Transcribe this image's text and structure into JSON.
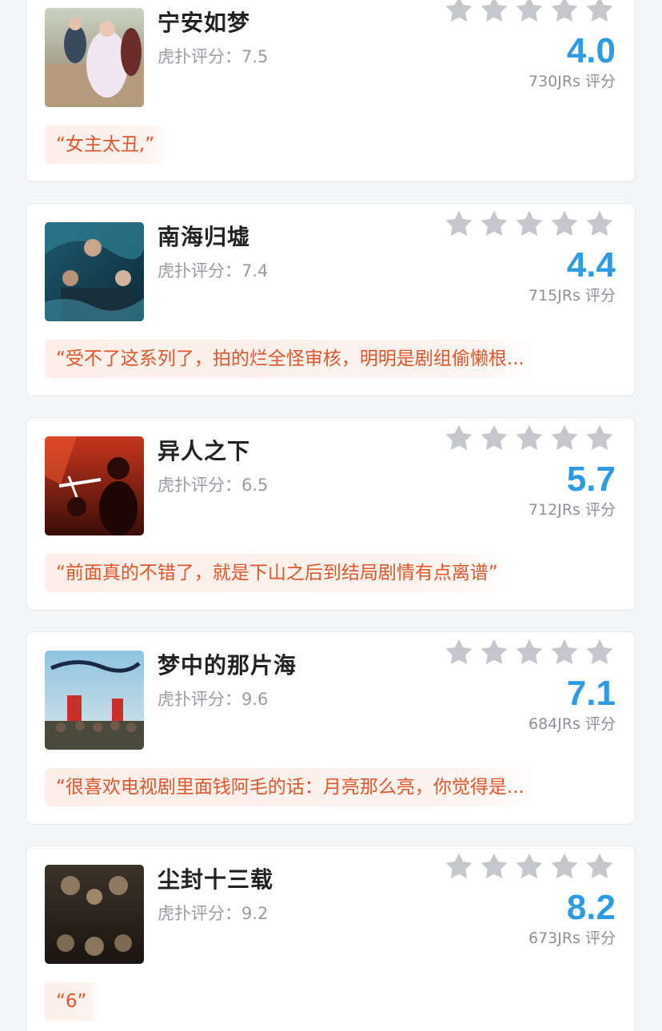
{
  "colors": {
    "rating": "#2f9be3",
    "quote_text": "#e2562e",
    "star_empty": "#c5c7cd",
    "background": "#f4f5f7"
  },
  "items": [
    {
      "title": "宁安如梦",
      "hupu_score": "虎扑评分：7.5",
      "rating": "4.0",
      "votes": "730JRs 评分",
      "quote": "“女主太丑,”",
      "stars_filled": 0,
      "poster_icon": "drama-poster-image"
    },
    {
      "title": "南海归墟",
      "hupu_score": "虎扑评分：7.4",
      "rating": "4.4",
      "votes": "715JRs 评分",
      "quote": "“受不了这系列了，拍的烂全怪审核，明明是剧组偷懒根...",
      "stars_filled": 0,
      "poster_icon": "drama-poster-image"
    },
    {
      "title": "异人之下",
      "hupu_score": "虎扑评分：6.5",
      "rating": "5.7",
      "votes": "712JRs 评分",
      "quote": "“前面真的不错了，就是下山之后到结局剧情有点离谱”",
      "stars_filled": 0,
      "poster_icon": "drama-poster-image"
    },
    {
      "title": "梦中的那片海",
      "hupu_score": "虎扑评分：9.6",
      "rating": "7.1",
      "votes": "684JRs 评分",
      "quote": "“很喜欢电视剧里面钱阿毛的话：月亮那么亮，你觉得是...",
      "stars_filled": 0,
      "poster_icon": "drama-poster-image"
    },
    {
      "title": "尘封十三载",
      "hupu_score": "虎扑评分：9.2",
      "rating": "8.2",
      "votes": "673JRs 评分",
      "quote": "“6”",
      "stars_filled": 0,
      "poster_icon": "drama-poster-image"
    }
  ]
}
